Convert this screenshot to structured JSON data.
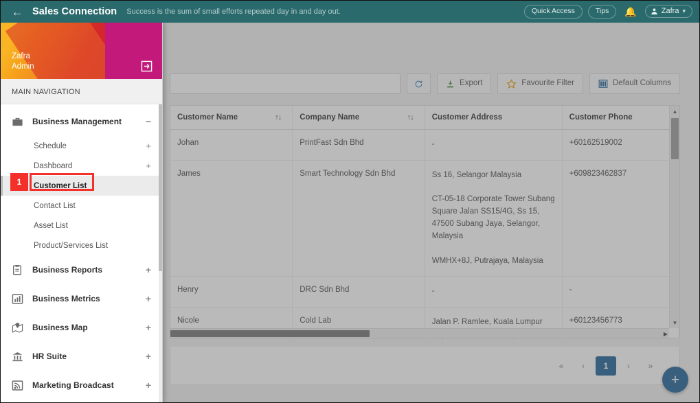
{
  "topbar": {
    "back_icon": "back-arrow-icon",
    "brand": "Sales Connection",
    "tagline": "Success is the sum of small efforts repeated day in and day out.",
    "quick_access": "Quick Access",
    "tips": "Tips",
    "bell_icon": "bell-icon",
    "user_name": "Zafra",
    "caret": "∨"
  },
  "sidebar": {
    "user_name": "Zafra",
    "user_role": "Admin",
    "logout_icon": "logout-icon",
    "section_title": "MAIN NAVIGATION",
    "groups": [
      {
        "label": "Business Management",
        "icon": "briefcase-icon",
        "expander": "−",
        "children": [
          {
            "label": "Schedule",
            "expander": "+",
            "active": false
          },
          {
            "label": "Dashboard",
            "expander": "+",
            "active": false
          },
          {
            "label": "Customer List",
            "expander": "",
            "active": true
          },
          {
            "label": "Contact List",
            "expander": "",
            "active": false
          },
          {
            "label": "Asset List",
            "expander": "",
            "active": false
          },
          {
            "label": "Product/Services List",
            "expander": "",
            "active": false
          }
        ]
      },
      {
        "label": "Business Reports",
        "icon": "clipboard-icon",
        "expander": "+",
        "children": []
      },
      {
        "label": "Business Metrics",
        "icon": "bar-chart-icon",
        "expander": "+",
        "children": []
      },
      {
        "label": "Business Map",
        "icon": "map-pin-icon",
        "expander": "+",
        "children": []
      },
      {
        "label": "HR Suite",
        "icon": "bank-icon",
        "expander": "+",
        "children": []
      },
      {
        "label": "Marketing Broadcast",
        "icon": "broadcast-icon",
        "expander": "+",
        "children": []
      }
    ]
  },
  "toolbar": {
    "search_placeholder": "",
    "search_value": "",
    "refresh_icon": "refresh-icon",
    "export_label": "Export",
    "export_icon": "download-icon",
    "favourite_filter_label": "Favourite Filter",
    "favourite_filter_icon": "star-icon",
    "default_columns_label": "Default Columns",
    "default_columns_icon": "columns-icon"
  },
  "table": {
    "columns": [
      {
        "label": "Customer Name",
        "sortable": true,
        "sort_icon": "↑↓"
      },
      {
        "label": "Company Name",
        "sortable": true,
        "sort_icon": "↑↓"
      },
      {
        "label": "Customer Address",
        "sortable": false,
        "sort_icon": ""
      },
      {
        "label": "Customer Phone",
        "sortable": false,
        "sort_icon": ""
      }
    ],
    "rows": [
      {
        "customer_name": "Johan",
        "company_name": "PrintFast Sdn Bhd",
        "customer_address": "-",
        "customer_phone": "+60162519002"
      },
      {
        "customer_name": "James",
        "company_name": "Smart Technology Sdn Bhd",
        "customer_address": "Ss 16, Selangor Malaysia\n\nCT-05-18 Corporate Tower Subang Square Jalan SS15/4G, Ss 15, 47500 Subang Jaya, Selangor, Malaysia\n\nWMHX+8J, Putrajaya, Malaysia",
        "customer_phone": "+609823462837"
      },
      {
        "customer_name": "Henry",
        "company_name": "DRC Sdn Bhd",
        "customer_address": "-",
        "customer_phone": "-"
      },
      {
        "customer_name": "Nicole",
        "company_name": "Cold Lab",
        "customer_address": "Jalan P. Ramlee, Kuala Lumpur City Centre Kuala Lumpur",
        "customer_phone": "+60123456773"
      }
    ]
  },
  "pagination": {
    "first": "«",
    "prev": "‹",
    "current_page": "1",
    "next": "›",
    "last": "»"
  },
  "fab": {
    "label": "+"
  },
  "annotation": {
    "badge": "1",
    "target": "Customer List"
  },
  "colors": {
    "topbar": "#2b6a6c",
    "accent_blue": "#1f6298",
    "annotation_red": "#f3302a",
    "export_green": "#2f7d32",
    "star_orange": "#e8a317"
  }
}
